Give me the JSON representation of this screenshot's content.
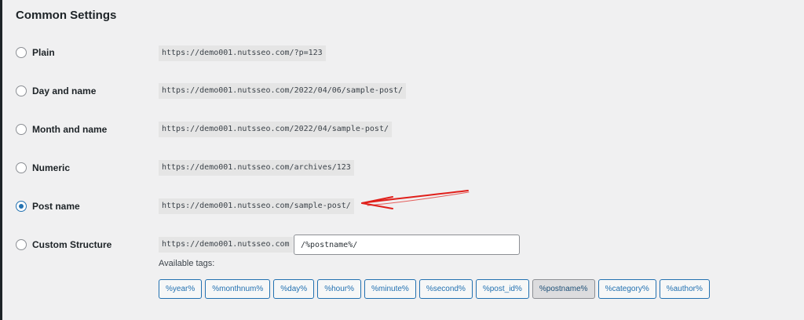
{
  "section_title": "Common Settings",
  "options": [
    {
      "label": "Plain",
      "example": "https://demo001.nutsseo.com/?p=123",
      "checked": false
    },
    {
      "label": "Day and name",
      "example": "https://demo001.nutsseo.com/2022/04/06/sample-post/",
      "checked": false
    },
    {
      "label": "Month and name",
      "example": "https://demo001.nutsseo.com/2022/04/sample-post/",
      "checked": false
    },
    {
      "label": "Numeric",
      "example": "https://demo001.nutsseo.com/archives/123",
      "checked": false
    },
    {
      "label": "Post name",
      "example": "https://demo001.nutsseo.com/sample-post/",
      "checked": true
    },
    {
      "label": "Custom Structure",
      "example": "https://demo001.nutsseo.com",
      "checked": false
    }
  ],
  "custom_structure": {
    "value": "/%postname%/",
    "available_tags_label": "Available tags:",
    "tags": [
      "%year%",
      "%monthnum%",
      "%day%",
      "%hour%",
      "%minute%",
      "%second%",
      "%post_id%",
      "%postname%",
      "%category%",
      "%author%"
    ],
    "active_tag": "%postname%"
  },
  "colors": {
    "accent": "#2271b1",
    "annotation": "#e0201b"
  },
  "icons": {
    "annotation": "red-arrow-icon"
  }
}
